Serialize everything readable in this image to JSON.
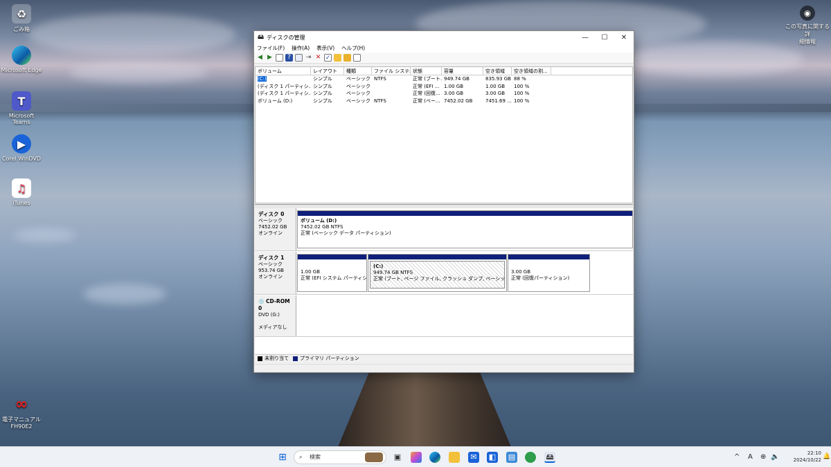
{
  "desktop": {
    "icons": [
      {
        "label": "ごみ箱"
      },
      {
        "label": "Microsoft Edge"
      },
      {
        "label": "Microsoft Teams"
      },
      {
        "label": "Corel WinDVD"
      },
      {
        "label": "iTunes"
      },
      {
        "label": "電子マニュアル FH90E2"
      }
    ],
    "right_icon_label_1": "この写真に関する詳",
    "right_icon_label_2": "細情報"
  },
  "window": {
    "title": "ディスクの管理",
    "controls": {
      "minimize": "—",
      "maximize": "☐",
      "close": "✕"
    },
    "menu": [
      "ファイル(F)",
      "操作(A)",
      "表示(V)",
      "ヘルプ(H)"
    ],
    "columns": [
      "ボリューム",
      "レイアウト",
      "種類",
      "ファイル システム",
      "状態",
      "容量",
      "空き領域",
      "空き領域の割..."
    ],
    "volumes": [
      {
        "name": "(C:)",
        "layout": "シンプル",
        "type": "ベーシック",
        "fs": "NTFS",
        "status": "正常 (ブート...",
        "capacity": "949.74 GB",
        "free": "835.93 GB",
        "pct": "88 %"
      },
      {
        "name": "(ディスク 1 パーティシ...",
        "layout": "シンプル",
        "type": "ベーシック",
        "fs": "",
        "status": "正常 (EFI ...",
        "capacity": "1.00 GB",
        "free": "1.00 GB",
        "pct": "100 %"
      },
      {
        "name": "(ディスク 1 パーティシ...",
        "layout": "シンプル",
        "type": "ベーシック",
        "fs": "",
        "status": "正常 (回復...",
        "capacity": "3.00 GB",
        "free": "3.00 GB",
        "pct": "100 %"
      },
      {
        "name": "ボリューム (D:)",
        "layout": "シンプル",
        "type": "ベーシック",
        "fs": "NTFS",
        "status": "正常 (ベー...",
        "capacity": "7452.02 GB",
        "free": "7451.69 ...",
        "pct": "100 %"
      }
    ],
    "disks": {
      "disk0": {
        "name": "ディスク 0",
        "kind": "ベーシック",
        "size": "7452.02 GB",
        "state": "オンライン",
        "partition": {
          "title": "ボリューム  (D:)",
          "line2": "7452.02 GB NTFS",
          "line3": "正常 (ベーシック データ パーティション)"
        }
      },
      "disk1": {
        "name": "ディスク 1",
        "kind": "ベーシック",
        "size": "953.74 GB",
        "state": "オンライン",
        "p1": {
          "line1": "1.00 GB",
          "line2": "正常 (EFI システム パーティション)"
        },
        "p2": {
          "title": "(C:)",
          "line2": "949.74 GB NTFS",
          "line3": "正常 (ブート, ページ ファイル, クラッシュ ダンプ, ベーシック データ パー"
        },
        "p3": {
          "line1": "3.00 GB",
          "line2": "正常 (回復パーティション)"
        }
      },
      "cdrom0": {
        "name": "CD-ROM 0",
        "kind": "DVD (G:)",
        "state": "メディアなし"
      }
    },
    "legend": {
      "unallocated": "未割り当て",
      "primary": "プライマリ パーティション"
    },
    "colors": {
      "primary": "#0f1f7a",
      "unallocated": "#000000",
      "selection": "#0a64d6"
    }
  },
  "taskbar": {
    "search_placeholder": "検索",
    "clock_time": "22:10",
    "clock_date": "2024/10/22",
    "tray_lang": "A"
  }
}
